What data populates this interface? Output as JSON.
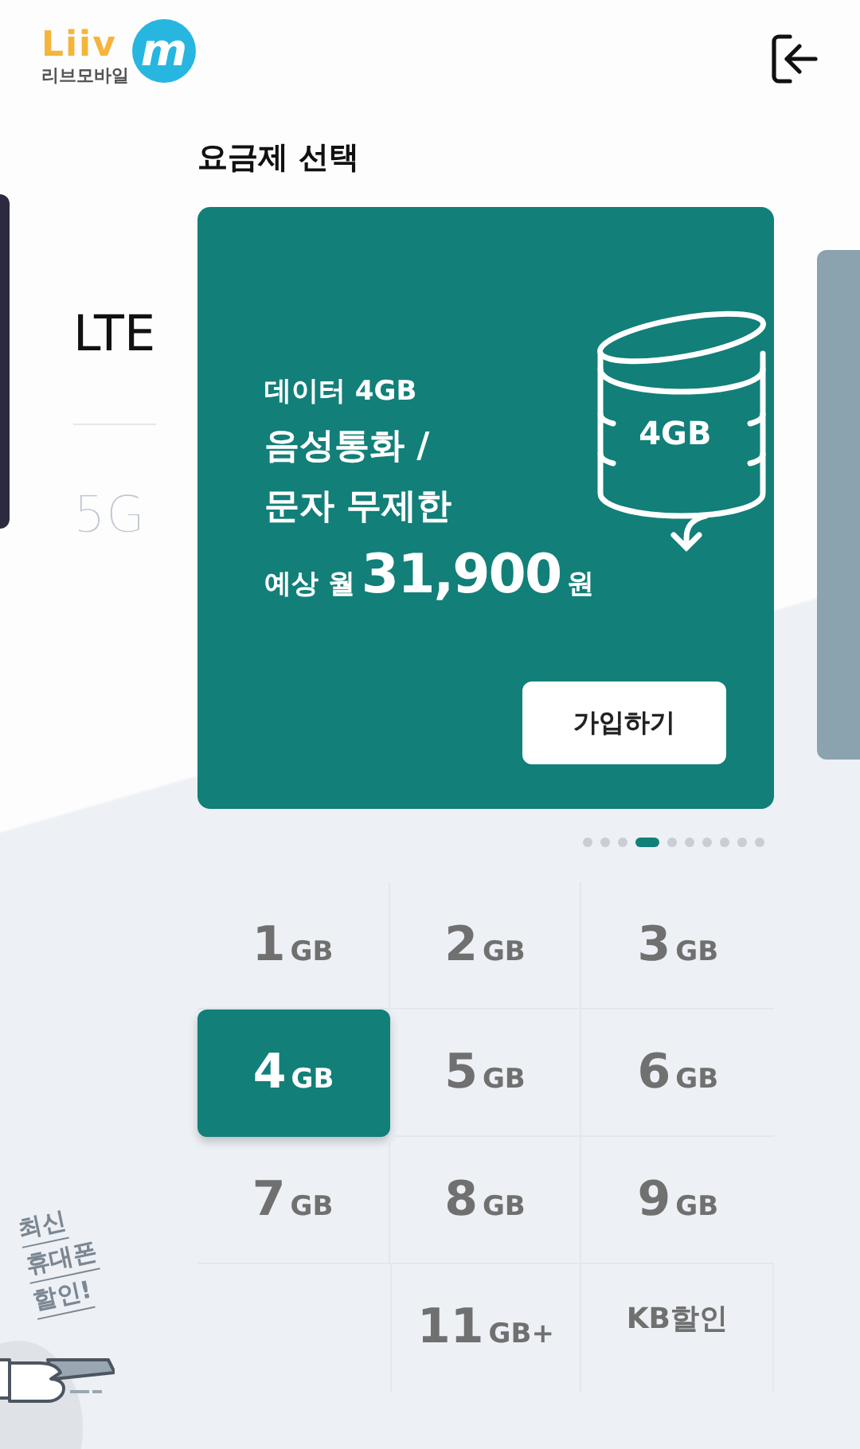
{
  "header": {
    "logo": {
      "wordmark": "Liiv",
      "mark": "m",
      "subtitle": "리브모바일"
    }
  },
  "network_tabs": [
    {
      "label": "LTE",
      "selected": true
    },
    {
      "label": "5G",
      "selected": false
    }
  ],
  "section_title": "요금제 선택",
  "plan_card": {
    "data_line": "데이터 4GB",
    "voice_line": "음성통화 /",
    "sms_line": "문자 무제한",
    "price_prefix": "예상 월",
    "price": "31,900",
    "price_unit": "원",
    "icon_label": "4GB",
    "button": "가입하기"
  },
  "pager": [
    {
      "selected": false
    },
    {
      "selected": false
    },
    {
      "selected": false
    },
    {
      "selected": true
    },
    {
      "selected": false
    },
    {
      "selected": false
    },
    {
      "selected": false
    },
    {
      "selected": false
    },
    {
      "selected": false
    },
    {
      "selected": false
    }
  ],
  "options": [
    {
      "kind": "amount",
      "amount": "1",
      "unit": "GB",
      "selected": false
    },
    {
      "kind": "amount",
      "amount": "2",
      "unit": "GB",
      "selected": false
    },
    {
      "kind": "amount",
      "amount": "3",
      "unit": "GB",
      "selected": false
    },
    {
      "kind": "amount",
      "amount": "4",
      "unit": "GB",
      "selected": true
    },
    {
      "kind": "amount",
      "amount": "5",
      "unit": "GB",
      "selected": false
    },
    {
      "kind": "amount",
      "amount": "6",
      "unit": "GB",
      "selected": false
    },
    {
      "kind": "amount",
      "amount": "7",
      "unit": "GB",
      "selected": false
    },
    {
      "kind": "amount",
      "amount": "8",
      "unit": "GB",
      "selected": false
    },
    {
      "kind": "amount",
      "amount": "9",
      "unit": "GB",
      "selected": false
    },
    {
      "kind": "amount",
      "amount": "11",
      "unit": "GB+",
      "selected": false
    },
    {
      "kind": "text",
      "label": "KB할인",
      "selected": false
    }
  ],
  "promo": {
    "lines": [
      "최신",
      "휴대폰",
      "할인!"
    ]
  }
}
